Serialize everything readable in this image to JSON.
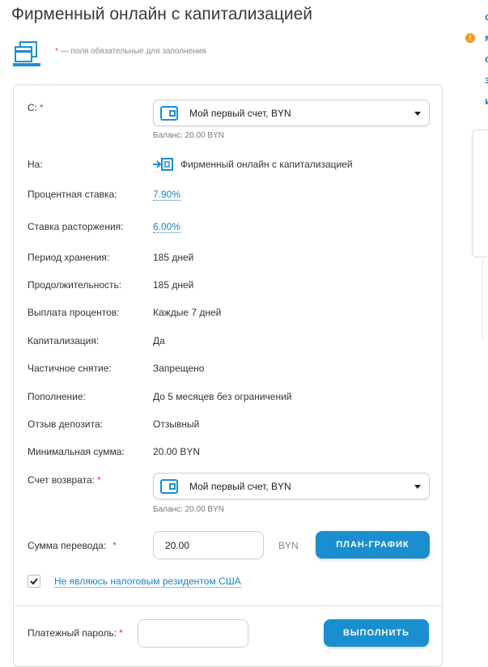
{
  "page": {
    "title": "Фирменный онлайн с капитализацией",
    "required_note_star": "*",
    "required_note": " — поля обязательные для заполнения"
  },
  "form": {
    "from": {
      "label": "С:",
      "star": "*",
      "selected": "Мой первый счет, BYN",
      "balance": "Баланс: 20.00 BYN"
    },
    "to": {
      "label": "На:",
      "value": "Фирменный онлайн с капитализацией"
    },
    "details": [
      {
        "label": "Процентная ставка:",
        "value": "7.90%",
        "link": true
      },
      {
        "label": "Ставка расторжения:",
        "value": "6.00%",
        "link": true
      },
      {
        "label": "Период хранения:",
        "value": "185 дней",
        "link": false
      },
      {
        "label": "Продолжительность:",
        "value": "185 дней",
        "link": false
      },
      {
        "label": "Выплата процентов:",
        "value": "Каждые 7 дней",
        "link": false
      },
      {
        "label": "Капитализация:",
        "value": "Да",
        "link": false
      },
      {
        "label": "Частичное снятие:",
        "value": "Запрещено",
        "link": false
      },
      {
        "label": "Пополнение:",
        "value": "До 5 месяцев без ограничений",
        "link": false
      },
      {
        "label": "Отзыв депозита:",
        "value": "Отзывный",
        "link": false
      },
      {
        "label": "Минимальная сумма:",
        "value": "20.00 BYN",
        "link": false
      }
    ],
    "return_account": {
      "label": "Счет возврата:",
      "star": "*",
      "selected": "Мой первый счет, BYN",
      "balance": "Баланс: 20.00 BYN"
    },
    "amount": {
      "label": "Сумма перевода:",
      "star": "*",
      "value": "20.00",
      "currency": "BYN",
      "schedule_button": "ПЛАН-ГРАФИК"
    },
    "tax_checkbox": {
      "checked": true,
      "label": "Не являюсь налоговым резидентом США"
    },
    "password": {
      "label": "Платежный пароль:",
      "star": "*",
      "value": "",
      "submit_button": "ВЫПОЛНИТЬ"
    }
  },
  "side": {
    "links": [
      "с",
      "м",
      "с",
      "з",
      "и"
    ],
    "warn_icon": "!"
  },
  "colors": {
    "accent": "#1a8fd0",
    "link": "#1d80c3",
    "required": "#e0362f",
    "warning": "#f29a1d"
  }
}
